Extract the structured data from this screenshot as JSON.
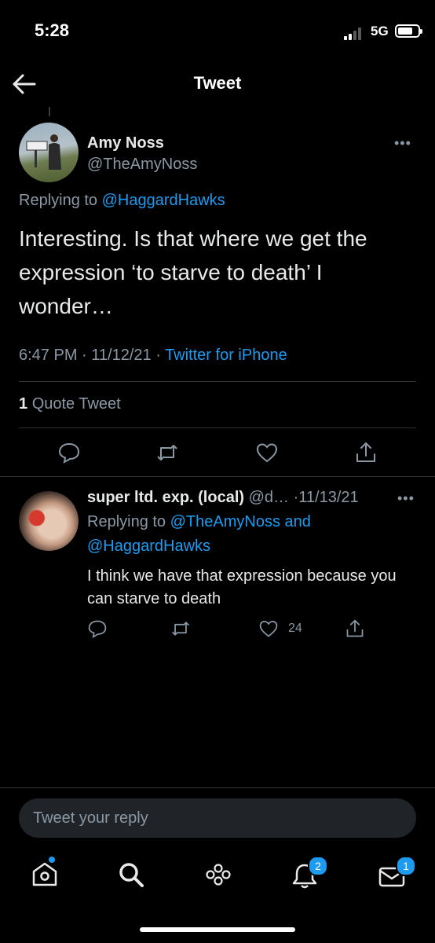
{
  "status_bar": {
    "time": "5:28",
    "network": "5G"
  },
  "header": {
    "title": "Tweet"
  },
  "main_tweet": {
    "author_name": "Amy Noss",
    "author_handle": "@TheAmyNoss",
    "replying_prefix": "Replying to",
    "replying_to": "@HaggardHawks",
    "text": "Interesting. Is that where we get the expression ‘to starve to death’ I wonder…",
    "time": "6:47 PM",
    "date": "11/12/21",
    "source": "Twitter for iPhone",
    "quote_count": "1",
    "quote_label": "Quote Tweet",
    "more": "•••"
  },
  "reply_tweet": {
    "author_name": "super ltd. exp. (local)",
    "author_handle": "@d…",
    "date": "·11/13/21",
    "replying_prefix": "Replying to",
    "replying_to_1": "@TheAmyNoss and",
    "replying_to_2": "@HaggardHawks",
    "text": "I think we have that expression because you can starve to death",
    "like_count": "24",
    "more": "•••"
  },
  "reply_box": {
    "placeholder": "Tweet your reply"
  },
  "tab_bar": {
    "notifications_badge": "2",
    "messages_badge": "1"
  },
  "colors": {
    "accent": "#1d9bf0",
    "background": "#000000",
    "muted": "#8b98a5"
  }
}
